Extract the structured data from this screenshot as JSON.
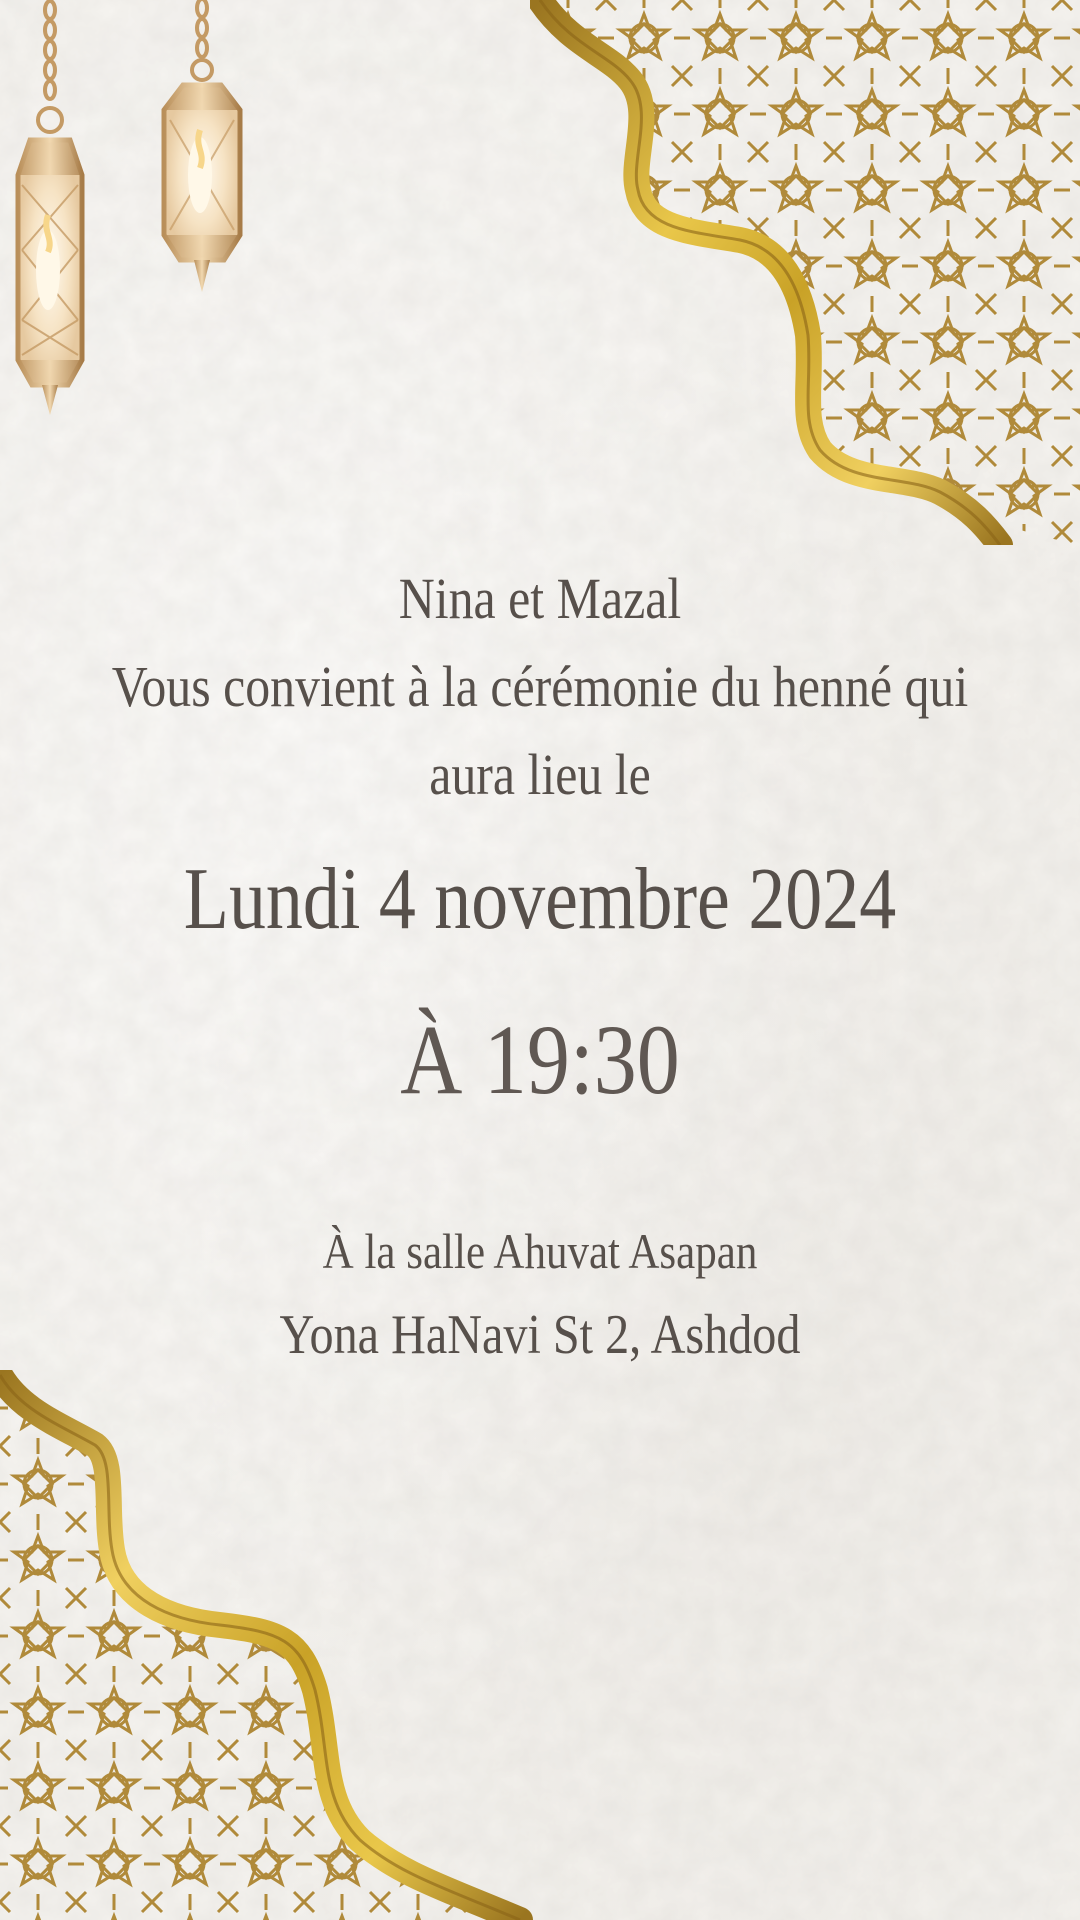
{
  "invitation": {
    "hosts": "Nina et Mazal",
    "invitation_line1": "Vous convient à la cérémonie du henné qui",
    "invitation_line2": "aura lieu le",
    "date": "Lundi 4 novembre 2024",
    "time": "À 19:30",
    "venue": "À la salle Ahuvat Asapan",
    "address": "Yona HaNavi St 2, Ashdod"
  },
  "decor": {
    "top_left": "hanging-lanterns-illustration",
    "top_right": "gold-arabesque-corner-pattern",
    "bottom_left": "gold-arabesque-corner-pattern"
  },
  "colors": {
    "text": "#57504b",
    "gold": "#c9a227",
    "gold_dark": "#9a7520",
    "pattern": "#b08a3a",
    "paper": "#f5f3ef"
  }
}
